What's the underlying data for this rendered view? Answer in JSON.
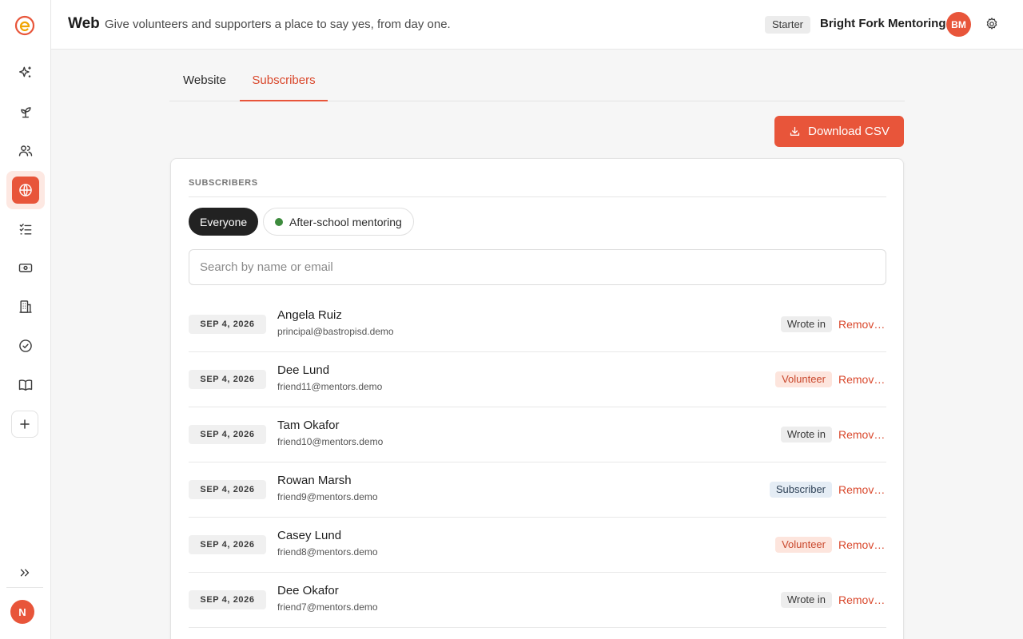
{
  "header": {
    "title": "Web",
    "subtitle": "Give volunteers and supporters a place to say yes, from day one.",
    "plan": "Starter",
    "org_name": "Bright Fork Mentoring",
    "org_initials": "BM"
  },
  "sidebar": {
    "user_initial": "N",
    "items": [
      "sparkles-icon",
      "sprout-icon",
      "people-icon",
      "globe-icon",
      "checklist-icon",
      "money-icon",
      "building-icon",
      "check-circle-icon",
      "book-icon",
      "plus-icon"
    ],
    "active": "globe-icon"
  },
  "tabs": [
    {
      "label": "Website"
    },
    {
      "label": "Subscribers",
      "active": true
    }
  ],
  "download_label": "Download CSV",
  "card": {
    "label": "SUBSCRIBERS",
    "filters": [
      {
        "label": "Everyone",
        "active": true
      },
      {
        "label": "After-school mentoring",
        "dot_color": "#3d8b3d"
      }
    ],
    "search_placeholder": "Search by name or email"
  },
  "rows": [
    {
      "date": "SEP 4, 2026",
      "name": "Angela Ruiz",
      "email": "principal@bastropisd.demo",
      "badge": "Wrote in",
      "badge_type": "wrote",
      "action": "Remove..."
    },
    {
      "date": "SEP 4, 2026",
      "name": "Dee Lund",
      "email": "friend11@mentors.demo",
      "badge": "Volunteer",
      "badge_type": "volunteer",
      "action": "Remove..."
    },
    {
      "date": "SEP 4, 2026",
      "name": "Tam Okafor",
      "email": "friend10@mentors.demo",
      "badge": "Wrote in",
      "badge_type": "wrote",
      "action": "Remove..."
    },
    {
      "date": "SEP 4, 2026",
      "name": "Rowan Marsh",
      "email": "friend9@mentors.demo",
      "badge": "Subscriber",
      "badge_type": "subscriber",
      "action": "Remove..."
    },
    {
      "date": "SEP 4, 2026",
      "name": "Casey Lund",
      "email": "friend8@mentors.demo",
      "badge": "Volunteer",
      "badge_type": "volunteer",
      "action": "Remove..."
    },
    {
      "date": "SEP 4, 2026",
      "name": "Dee Okafor",
      "email": "friend7@mentors.demo",
      "badge": "Wrote in",
      "badge_type": "wrote",
      "action": "Remove..."
    }
  ],
  "colors": {
    "accent": "#e8553a",
    "dark": "#222222"
  }
}
